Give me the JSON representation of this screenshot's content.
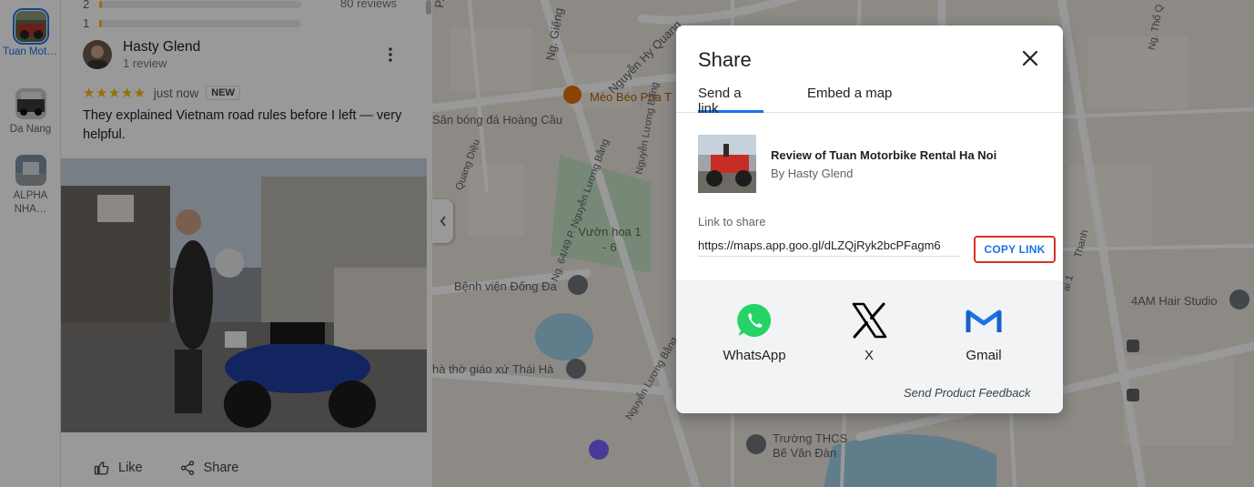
{
  "rail": {
    "items": [
      {
        "label": "Tuan Motorbi…"
      },
      {
        "label": "Da Nang"
      },
      {
        "label": "ALPHA NHA…"
      }
    ]
  },
  "panel": {
    "rating_rows": [
      {
        "stars": "2"
      },
      {
        "stars": "1"
      }
    ],
    "reviews_count": "80 reviews",
    "review": {
      "author": "Hasty Glend",
      "author_sub": "1 review",
      "stars": "★★★★★",
      "time": "just now",
      "badge": "NEW",
      "text": "They explained Vietnam road rules before I left — very helpful."
    },
    "actions": {
      "like": "Like",
      "share": "Share"
    }
  },
  "map": {
    "labels": {
      "street_1": "P. Hoàng Cầu",
      "street_2": "Nguyễn Hy Quang",
      "street_3": "Ng. Giếng",
      "place_meo": "Mèo Béo Pha T",
      "place_san": "Sân bóng đá Hoàng Cầu",
      "street_4": "Nguyễn Lương Bằng",
      "street_5": "Quang Diệu",
      "street_6": "Ng. 64/49 P. Nguyễn Lương Bằng",
      "park": "Vườn hoa 1 - 6",
      "hospital": "Bệnh viện Đống Đa",
      "church": "hà thờ giáo xứ Thái Hà",
      "street_7": "Nguyễn Lương Bằng",
      "school_1": "Trường THCS",
      "school_2": "Bế Văn Đàn",
      "hair": "4AM Hair Studio",
      "street_thanh": "Thanh",
      "street_ng_tho": "Ng. Thổ Q",
      "street_ai": "ai 1"
    }
  },
  "dialog": {
    "title": "Share",
    "tabs": [
      "Send a link",
      "Embed a map"
    ],
    "preview_title": "Review of Tuan Motorbike Rental Ha Noi",
    "preview_by": "By Hasty Glend",
    "link_label": "Link to share",
    "link_value": "https://maps.app.goo.gl/dLZQjRyk2bcPFagm6",
    "copy_label": "COPY LINK",
    "share_options": [
      {
        "label": "WhatsApp",
        "icon": "whatsapp-icon"
      },
      {
        "label": "X",
        "icon": "x-icon"
      },
      {
        "label": "Gmail",
        "icon": "gmail-icon"
      }
    ],
    "feedback": "Send Product Feedback"
  },
  "colors": {
    "accent": "#1a73e8",
    "copy_border": "#d93025",
    "star": "#fbbc04",
    "whatsapp": "#25d366"
  }
}
